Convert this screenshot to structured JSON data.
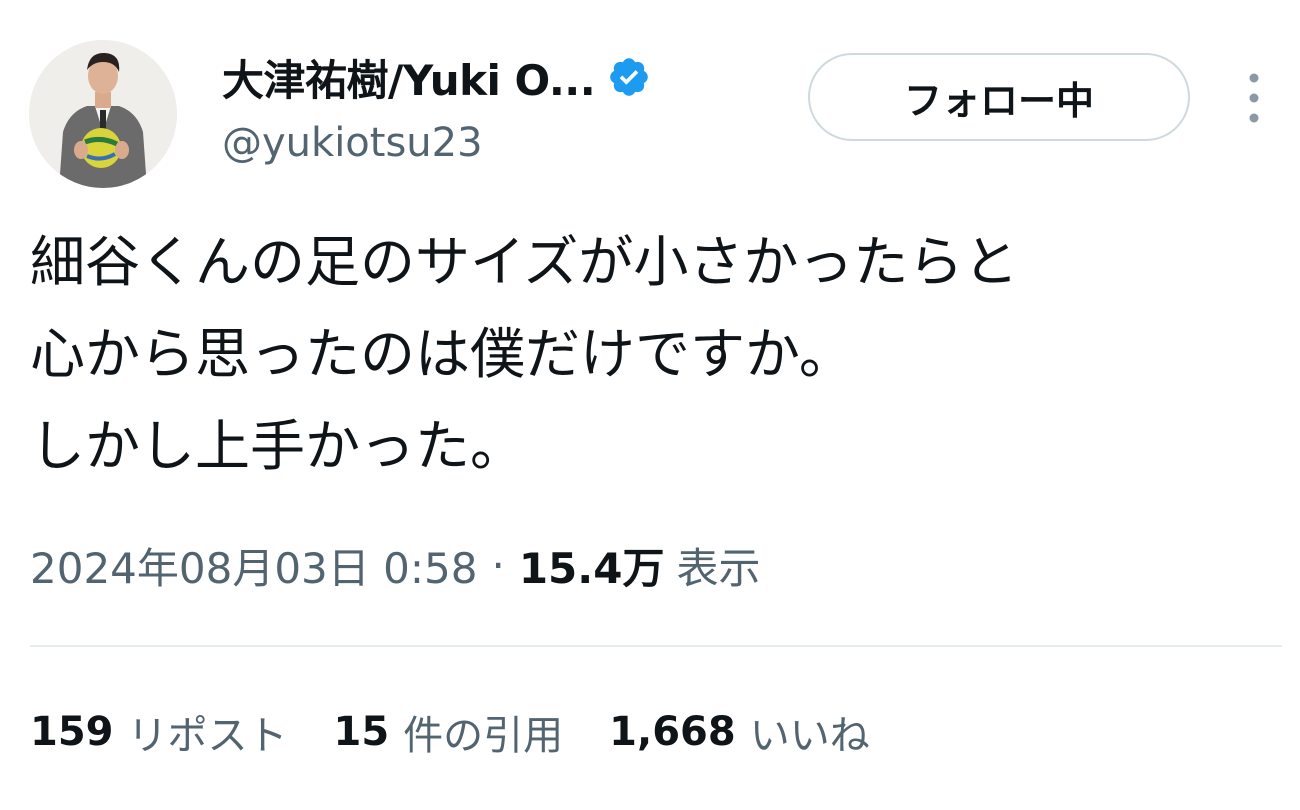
{
  "author": {
    "display_name": "大津祐樹/Yuki O...",
    "handle": "@yukiotsu23",
    "verified_icon": "verified-badge-icon",
    "avatar_icon": "avatar",
    "accent_color": "#1d9bf0"
  },
  "follow_button": {
    "label": "フォロー中"
  },
  "more_button": {
    "icon": "more-vertical-icon"
  },
  "tweet": {
    "lines": [
      "細谷くんの足のサイズが小さかったらと",
      "心から思ったのは僕だけですか。",
      "しかし上手かった。"
    ]
  },
  "meta": {
    "timestamp": "2024年08月03日 0:58",
    "separator": "·",
    "views_count": "15.4万",
    "views_label": "表示"
  },
  "stats": {
    "reposts": {
      "count": "159",
      "label": "リポスト"
    },
    "quotes": {
      "count": "15",
      "label": "件の引用"
    },
    "likes": {
      "count": "1,668",
      "label": "いいね"
    }
  }
}
